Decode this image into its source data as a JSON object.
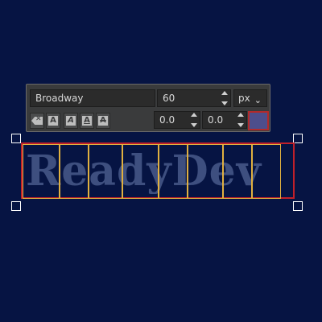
{
  "text_tool": {
    "font_name": "Broadway",
    "font_size": "60",
    "unit": "px",
    "unit_chevron": "⌄",
    "letter_spacing": "0.0",
    "line_spacing": "0.0",
    "color_swatch": "#4d4e8c",
    "style_buttons": [
      {
        "name": "clear-style",
        "glyph": ""
      },
      {
        "name": "bold",
        "glyph": "A"
      },
      {
        "name": "italic",
        "glyph": "A"
      },
      {
        "name": "underline",
        "glyph": "A"
      },
      {
        "name": "strikethrough",
        "glyph": "A"
      }
    ]
  },
  "canvas": {
    "text": "ReadyDev",
    "background": "#061443",
    "text_color": "#3e4f7f",
    "frame_color": "#c0202a",
    "glyph_box_color": "#e0b040"
  }
}
